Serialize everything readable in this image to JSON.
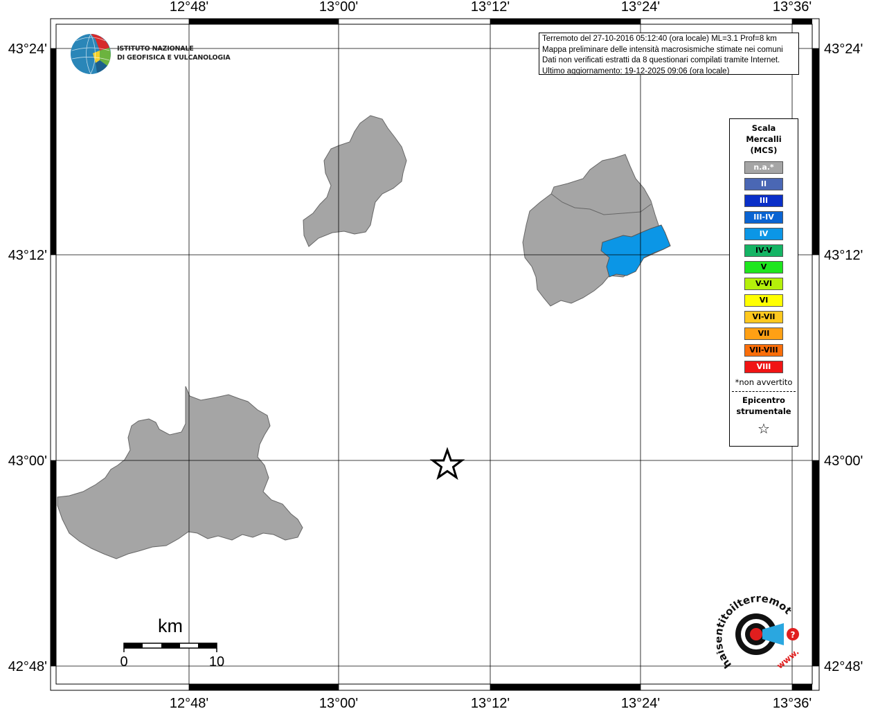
{
  "map": {
    "lon_labels": [
      "12°48'",
      "13°00'",
      "13°12'",
      "13°24'",
      "13°36'"
    ],
    "lat_labels": [
      "43°24'",
      "43°12'",
      "43°00'",
      "42°48'"
    ],
    "scale_bar": {
      "unit": "km",
      "min_label": "0",
      "max_label": "10"
    },
    "epicenter": {
      "symbol": "star",
      "lon": "13°08.8'",
      "lat": "42°59.9'"
    },
    "colors": {
      "not_felt": "#a5a5a5",
      "intensity_IV": "#0b96e6",
      "border": "#666666"
    }
  },
  "info_box": {
    "lines": [
      "Terremoto del 27-10-2016 05:12:40 (ora locale) ML=3.1 Prof=8 km",
      "Mappa preliminare delle intensità macrosismiche stimate nei comuni",
      "Dati non verificati estratti da 8 questionari compilati tramite Internet.",
      "Ultimo aggiornamento: 19-12-2025 09:06 (ora locale)"
    ]
  },
  "legend": {
    "title_lines": [
      "Scala",
      "Mercalli",
      "(MCS)"
    ],
    "items": [
      {
        "label": "n.a.*",
        "color": "#a5a5a5",
        "text_color": "#ffffff"
      },
      {
        "label": "II",
        "color": "#4a67b4",
        "text_color": "#ffffff"
      },
      {
        "label": "III",
        "color": "#0a2fc8",
        "text_color": "#ffffff"
      },
      {
        "label": "III-IV",
        "color": "#0a64d2",
        "text_color": "#ffffff"
      },
      {
        "label": "IV",
        "color": "#0b96e6",
        "text_color": "#ffffff"
      },
      {
        "label": "IV-V",
        "color": "#14b464",
        "text_color": "#000000"
      },
      {
        "label": "V",
        "color": "#1ee61e",
        "text_color": "#000000"
      },
      {
        "label": "V-VI",
        "color": "#b4f00a",
        "text_color": "#000000"
      },
      {
        "label": "VI",
        "color": "#ffff00",
        "text_color": "#000000"
      },
      {
        "label": "VI-VII",
        "color": "#ffc81e",
        "text_color": "#000000"
      },
      {
        "label": "VII",
        "color": "#ffa014",
        "text_color": "#000000"
      },
      {
        "label": "VII-VIII",
        "color": "#fa6e0a",
        "text_color": "#000000"
      },
      {
        "label": "VIII",
        "color": "#f01414",
        "text_color": "#ffffff"
      }
    ],
    "note": "*non avvertito",
    "epicenter_lines": [
      "Epicentro",
      "strumentale"
    ],
    "epicenter_symbol": "☆"
  },
  "logos": {
    "ingv_line1": "ISTITUTO NAZIONALE",
    "ingv_line2": "DI GEOFISICA E VULCANOLOGIA",
    "hai_sentito": "haisentitoilterremoto.it",
    "hai_sentito_www": "www."
  }
}
